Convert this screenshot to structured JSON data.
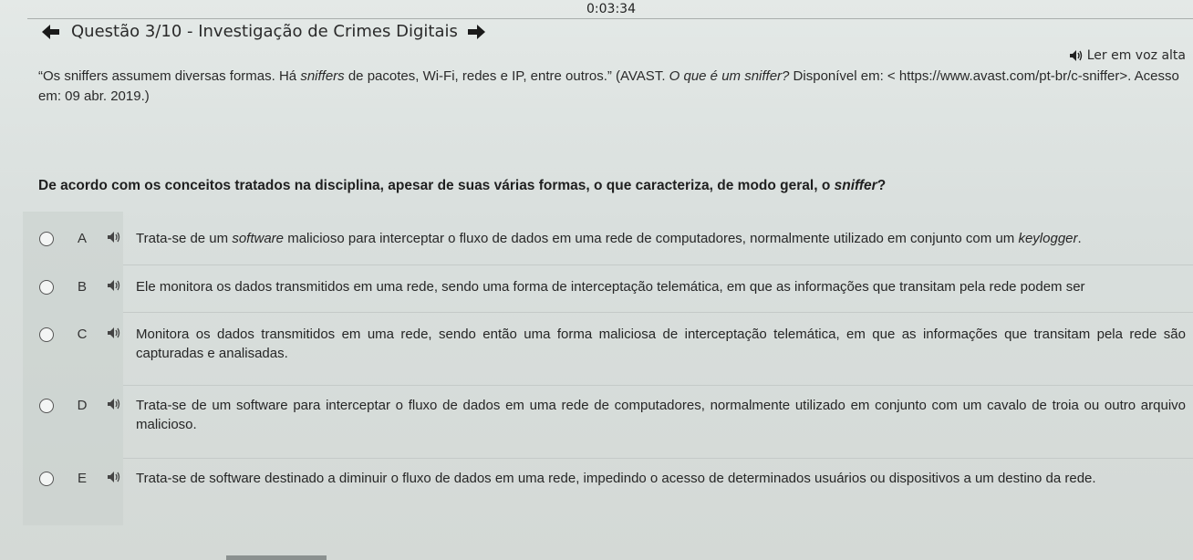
{
  "timer": "0:03:34",
  "header": {
    "title": "Questão 3/10 - Investigação de Crimes Digitais"
  },
  "read_aloud": "Ler em voz alta",
  "citation": {
    "part1": "“Os sniffers assumem diversas formas. Há ",
    "italic1": "sniffers",
    "part2": " de pacotes, Wi-Fi, redes e IP, entre outros.” (AVAST. ",
    "italic2": "O que é um sniffer?",
    "part3": " Disponível em: < https://www.avast.com/pt-br/c-sniffer>. Acesso em: 09 abr. 2019.)"
  },
  "question": {
    "main": "De acordo com os conceitos tratados na disciplina, apesar de suas várias formas, o que caracteriza, de modo geral, o ",
    "italic": "sniffer",
    "end": "?"
  },
  "options": [
    {
      "letter": "A",
      "pre": "Trata-se de um ",
      "it": "software",
      "post": " malicioso para interceptar o fluxo de dados em uma rede de computadores, normalmente utilizado em conjunto com um ",
      "it2": "keylogger",
      "end": "."
    },
    {
      "letter": "B",
      "pre": "Ele monitora os dados transmitidos em uma rede, sendo uma forma de interceptação telemática, em que as informações que transitam pela rede podem ser",
      "it": "",
      "post": "",
      "it2": "",
      "end": ""
    },
    {
      "letter": "C",
      "pre": "Monitora os dados transmitidos em uma rede, sendo então uma forma maliciosa de interceptação telemática, em que as informações que transitam pela rede são capturadas e analisadas.",
      "it": "",
      "post": "",
      "it2": "",
      "end": ""
    },
    {
      "letter": "D",
      "pre": "Trata-se de um software para interceptar o fluxo de dados em uma rede de computadores, normalmente utilizado em conjunto com um cavalo de troia ou outro arquivo malicioso.",
      "it": "",
      "post": "",
      "it2": "",
      "end": ""
    },
    {
      "letter": "E",
      "pre": "Trata-se de software destinado a diminuir o fluxo de dados em uma rede, impedindo o acesso de determinados usuários ou dispositivos a um destino da rede.",
      "it": "",
      "post": "",
      "it2": "",
      "end": ""
    }
  ],
  "icons": {
    "prev": "arrow-left-icon",
    "next": "arrow-right-icon",
    "speaker": "speaker-icon"
  }
}
